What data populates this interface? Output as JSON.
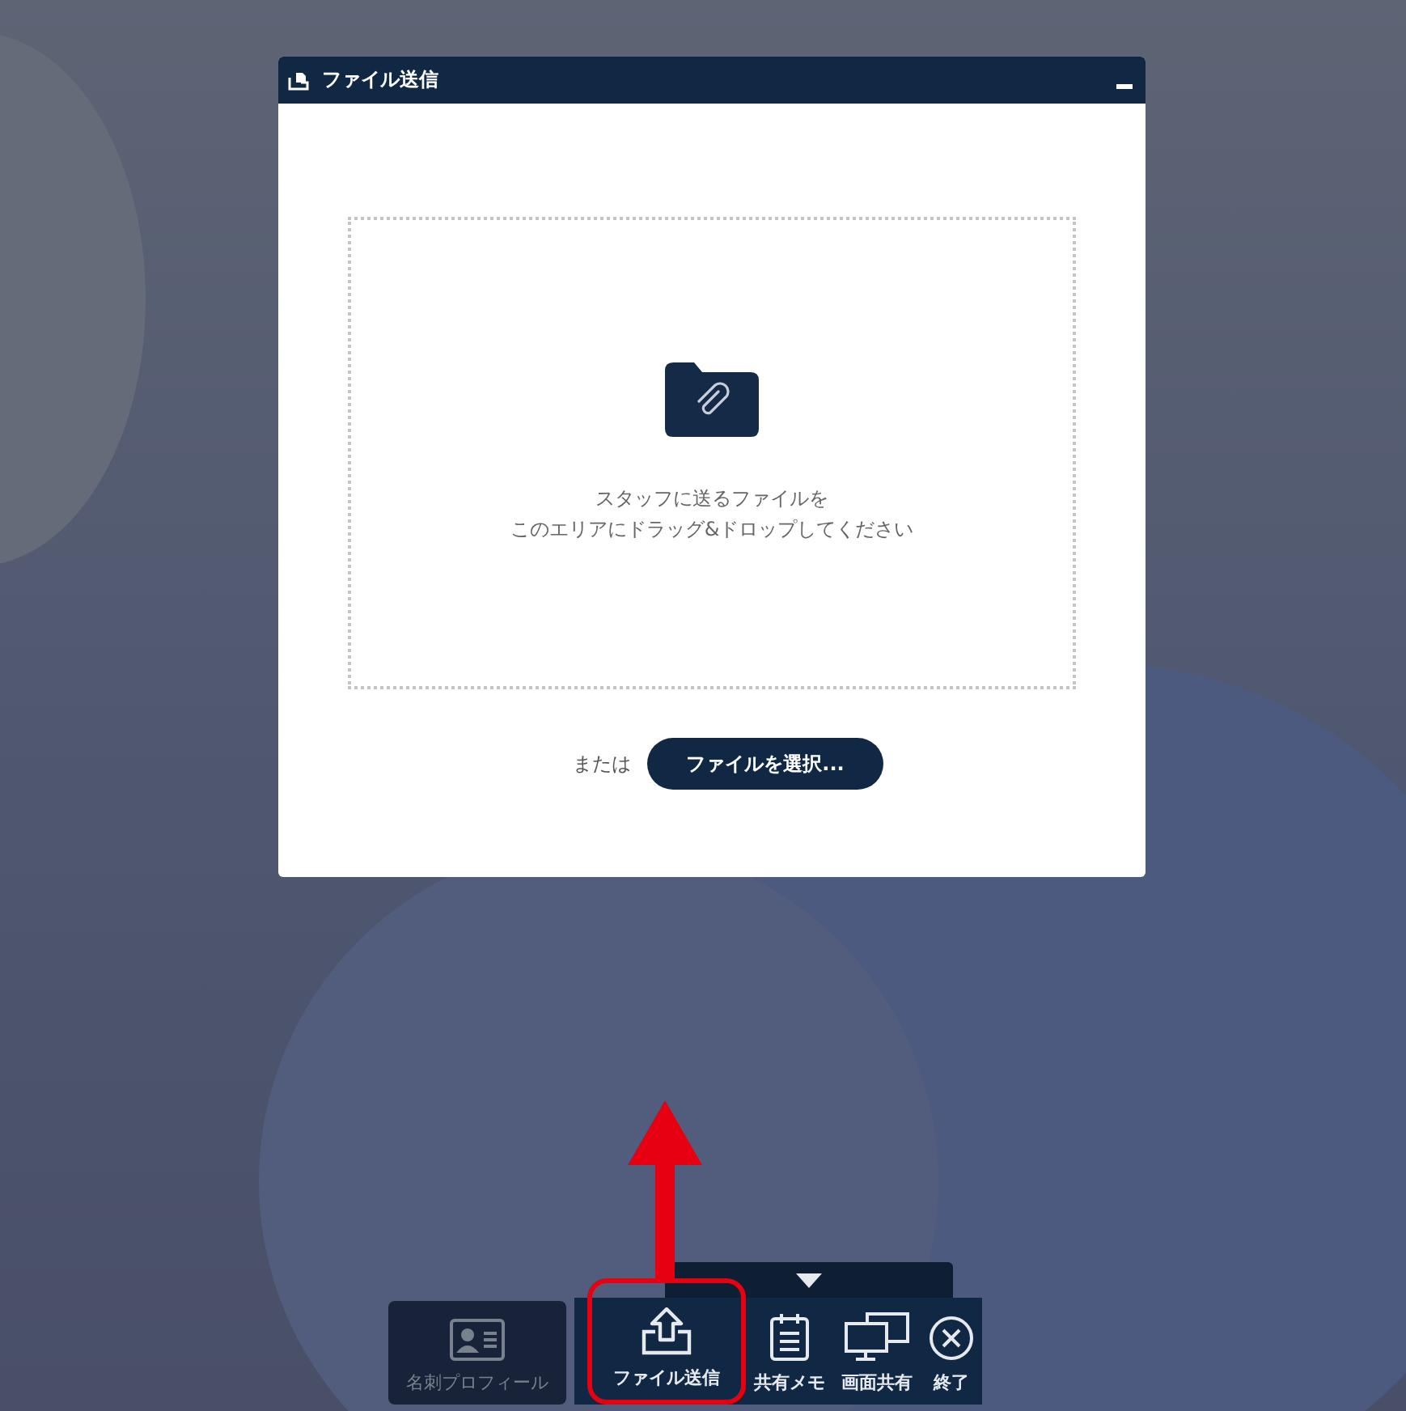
{
  "dialog": {
    "title": "ファイル送信",
    "drop_zone": {
      "lines": [
        "スタッフに送るファイルを",
        "このエリアにドラッグ&ドロップしてください"
      ]
    },
    "or_label": "または",
    "select_button": "ファイルを選択..."
  },
  "toolbar": {
    "items": [
      {
        "kind": "card",
        "label": "名刺プロフィール",
        "disabled": true,
        "highlighted": false
      },
      {
        "kind": "upload",
        "label": "ファイル送信",
        "disabled": false,
        "highlighted": true
      },
      {
        "kind": "memo",
        "label": "共有メモ",
        "disabled": false,
        "highlighted": false
      },
      {
        "kind": "screen",
        "label": "画面共有",
        "disabled": false,
        "highlighted": false
      },
      {
        "kind": "close",
        "label": "終了",
        "disabled": false,
        "highlighted": false
      }
    ]
  }
}
